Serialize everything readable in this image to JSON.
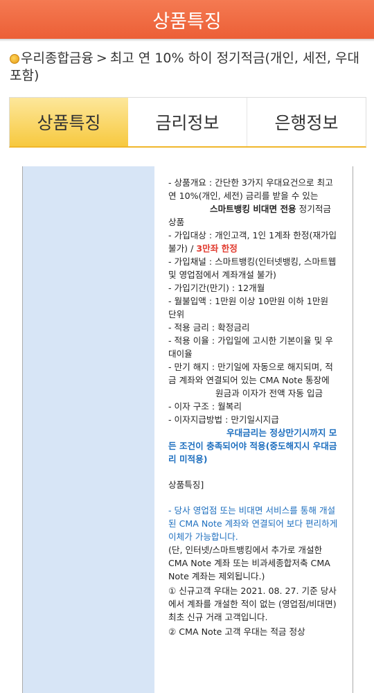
{
  "header": {
    "title": "상품특징"
  },
  "breadcrumb": {
    "parent": "우리종합금융",
    "separator": ">",
    "current": "최고 연 10% 하이 정기적금(개인, 세전, 우대 포함)"
  },
  "tabs": [
    {
      "label": "상품특징",
      "active": true
    },
    {
      "label": "금리정보",
      "active": false
    },
    {
      "label": "은행정보",
      "active": false
    }
  ],
  "content": {
    "overview_pre": " -  상품개요 : 간단한 3가지 우대요건으로 최고 연 10%(개인, 세전) 금리를 받을 수 있는",
    "overview_bold": "스마트뱅킹 비대면 전용",
    "overview_post": " 정기적금 상품",
    "target_pre": " - 가입대상 : 개인고객, 1인 1계좌 한정(재가입 불가) / ",
    "target_red": "3만좌 한정",
    "channel": " - 가입채널 : 스마트뱅킹(인터넷뱅킹, 스마트웹 및 영업점에서 계좌개설 불가)",
    "period": " - 가입기간(만기) : 12개월",
    "monthly": " - 월불입액 : 1만원 이상 10만원 이하 1만원 단위",
    "rate_applied": " - 적용 금리 : 확정금리",
    "rate_interest": " - 적용 이율 : 가입일에 고시한 기본이율 및 우대이율",
    "maturity_a": " - 만기 해지 : 만기일에 자동으로 해지되며, 적금 계좌와 연결되어 있는 CMA Note 통장에",
    "maturity_b": "원금과 이자가 전액 자동 입금",
    "interest_structure": " - 이자 구조 : 월복리",
    "interest_payment": " - 이자지급방법 : 만기일시지급",
    "note_blue": "우대금리는 정상만기시까지 모든 조건이 충족되어야 적용(중도해지시 우대금리 미적용)",
    "features_heading": "상품특징]",
    "link_blue": "- 당사 영업점 또는 비대면 서비스를 통해 개설된 CMA Note 계좌와 연결되어 보다 편리하게 이체가 가능합니다.",
    "exclusion": "(단, 인터넷/스마트뱅킹에서 추가로 개설한 CMA Note 계좌 또는 비과세종합저축 CMA Note 계좌는 제외됩니다.)",
    "new_customer": "① 신규고객 우대는 2021. 08. 27. 기준 당사에서 계좌를 개설한 적이 없는 (영업점/비대면) 최초 신규 거래 고객입니다.",
    "cma_customer": "② CMA Note 고객 우대는 적금 정상"
  }
}
